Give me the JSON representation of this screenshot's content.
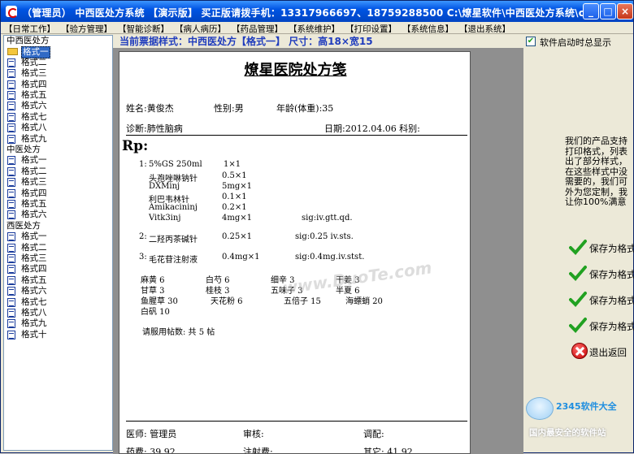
{
  "window": {
    "title": "（管理员） 中西医处方系统 【演示版】 买正版请拨手机：13317966697、18759288500 C:\\燎星软件\\中西医处方系统\\cfk.mdb",
    "minimize": "_",
    "maximize": "□",
    "close": "×"
  },
  "menu": [
    "【日常工作】",
    "【验方管理】",
    "【智能诊断】",
    "【病人病历】",
    "【药品管理】",
    "【系统维护】",
    "【打印设置】",
    "【系统信息】",
    "【退出系统】"
  ],
  "sidebar": {
    "groups": [
      {
        "label": "中西医处方",
        "items": [
          "格式一",
          "格式二",
          "格式三",
          "格式四",
          "格式五",
          "格式六",
          "格式七",
          "格式八",
          "格式九"
        ],
        "selected": "格式一"
      },
      {
        "label": "中医处方",
        "items": [
          "格式一",
          "格式二",
          "格式三",
          "格式四",
          "格式五",
          "格式六"
        ]
      },
      {
        "label": "西医处方",
        "items": [
          "格式一",
          "格式二",
          "格式三",
          "格式四",
          "格式五",
          "格式六",
          "格式七",
          "格式八",
          "格式九",
          "格式十"
        ]
      }
    ]
  },
  "header": {
    "current_style": "当前票据样式：中西医处方【格式一】 尺寸：高18×宽15",
    "startup_checkbox_label": "软件启动时总显示",
    "startup_checkbox_checked": true
  },
  "prescription": {
    "title": "燎星医院处方笺",
    "name": "姓名:黄俊杰",
    "sex": "性别:男",
    "age": "年龄(体重):35",
    "diagnosis": "诊断:肺性脑病",
    "date": "日期:2012.04.06 科别:",
    "rx": "Rp:",
    "western": [
      {
        "no": "1:",
        "drug": "5%GS 250ml",
        "dose": "1×1"
      },
      {
        "no": "",
        "drug": "头孢唑啉钠针",
        "dose": "0.5×1"
      },
      {
        "no": "",
        "drug": "DXMinj",
        "dose": "5mg×1"
      },
      {
        "no": "",
        "drug": "利巴韦林针",
        "dose": "0.1×1"
      },
      {
        "no": "",
        "drug": "Amikacininj",
        "dose": "0.2×1"
      },
      {
        "no": "",
        "drug": "Vitk3inj",
        "dose": "4mg×1",
        "sig": "sig:iv.gtt.qd."
      },
      {
        "no": "2:",
        "drug": "二羟丙茶碱针",
        "dose": "0.25×1",
        "sig": "sig:0.25 iv.sts."
      },
      {
        "no": "3:",
        "drug": "毛花苷注射液",
        "dose": "0.4mg×1",
        "sig": "sig:0.4mg.iv.stst."
      }
    ],
    "herbs": [
      [
        "麻黄 6",
        "白芍 6",
        "细辛 3",
        "干姜 3"
      ],
      [
        "甘草 3",
        "桂枝 3",
        "五味子 3",
        "半夏 6"
      ],
      [
        "鱼腥草 30",
        "天花粉 6",
        "五倍子 15",
        "海螵蛸 20"
      ],
      [
        "白矾 10"
      ]
    ],
    "doses": "请服用帖数: 共 5 帖",
    "doctor": "医师: 管理员",
    "review": "审核:",
    "dispense": "调配:",
    "drug_fee": "药费: 39.92",
    "injection_fee": "注射费:",
    "other_fee": "其它: 41.92"
  },
  "watermark": "www.DuoTe.com",
  "right_note": [
    "我们的产品支持",
    "打印格式，列表",
    "出了部分样式，",
    "在这些样式中没",
    "需要的，我们可",
    "外为您定制，我",
    "让你100%满意"
  ],
  "actions": [
    {
      "label": "保存为格式",
      "icon": "checkmark-icon"
    },
    {
      "label": "保存为格式",
      "icon": "checkmark-icon"
    },
    {
      "label": "保存为格式",
      "icon": "checkmark-icon"
    },
    {
      "label": "保存为格式",
      "icon": "checkmark-icon"
    },
    {
      "label": "退出返回",
      "icon": "exit-icon"
    }
  ],
  "logo": {
    "brand": "2345软件大全",
    "sub": "国内最安全的软件站"
  },
  "colors": {
    "title_bar": "#0054e3",
    "selected": "#316ac5",
    "header_text": "#1f3cbd",
    "check": "#21a121"
  }
}
